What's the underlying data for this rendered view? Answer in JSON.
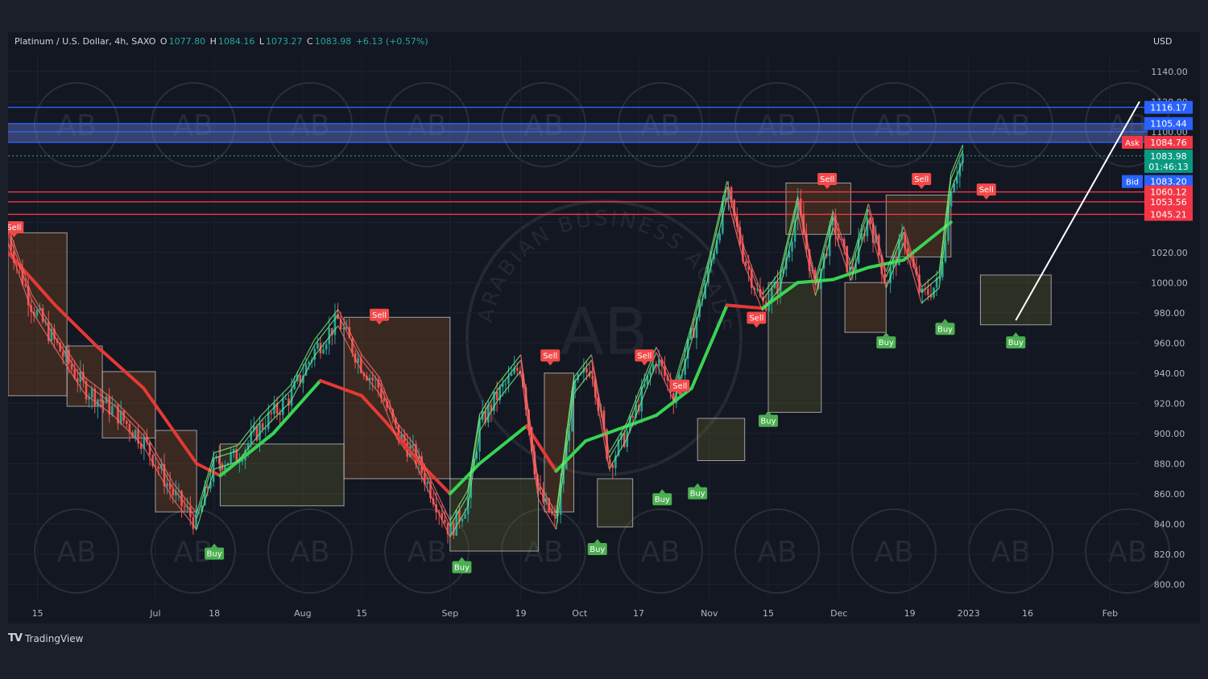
{
  "header": {
    "symbol": "Platinum / U.S. Dollar, 4h, SAXO",
    "open_label": "O",
    "open": "1077.80",
    "high_label": "H",
    "high": "1084.16",
    "low_label": "L",
    "low": "1073.27",
    "close_label": "C",
    "close": "1083.98",
    "change": "+6.13 (+0.57%)"
  },
  "currency": "USD",
  "footer": {
    "brand": "TradingView",
    "logo_icon": "tradingview-logo-icon"
  },
  "watermark": {
    "text": "ARABIAN BUSINESS ACADEMY",
    "monogram": "AB"
  },
  "colors": {
    "background": "#131722",
    "bull": "#26a69a",
    "bear": "#ef5350",
    "sell_label": "#f24a4a",
    "buy_label": "#4caf50",
    "resistance_blue": "#2962ff",
    "support_red": "#f23645",
    "trendline": "#ffffff"
  },
  "chart_data": {
    "type": "line",
    "title": "Platinum / U.S. Dollar, 4h, SAXO",
    "ylabel": "USD",
    "ylim": [
      790,
      1150
    ],
    "y_ticks": [
      "1140.00",
      "1120.00",
      "1100.00",
      "1020.00",
      "1000.00",
      "980.00",
      "960.00",
      "940.00",
      "920.00",
      "900.00",
      "880.00",
      "860.00",
      "840.00",
      "820.00",
      "800.00"
    ],
    "x_ticks": [
      "15",
      "Jul",
      "18",
      "Aug",
      "15",
      "Sep",
      "19",
      "Oct",
      "17",
      "Nov",
      "15",
      "Dec",
      "19",
      "2023",
      "16",
      "Feb"
    ],
    "x_tick_pos": [
      0.5,
      2.5,
      3.5,
      5.0,
      6.0,
      7.5,
      8.7,
      9.7,
      10.7,
      11.9,
      12.9,
      14.1,
      15.3,
      16.3,
      17.3,
      18.7
    ],
    "x_range": [
      0,
      19.2
    ],
    "series": [
      {
        "type": "price",
        "x": [
          0,
          0.4,
          0.8,
          1.3,
          1.8,
          2.3,
          2.8,
          3.2,
          3.5,
          3.9,
          4.3,
          4.8,
          5.2,
          5.6,
          6.0,
          6.3,
          6.6,
          6.9,
          7.2,
          7.5,
          7.8,
          8.0,
          8.3,
          8.7,
          9.0,
          9.3,
          9.6,
          9.9,
          10.2,
          10.5,
          10.8,
          11.0,
          11.3,
          11.6,
          11.9,
          12.2,
          12.5,
          12.8,
          13.1,
          13.4,
          13.7,
          14.0,
          14.3,
          14.6,
          14.9,
          15.2,
          15.5,
          15.8,
          16.0,
          16.2
        ],
        "values": [
          1030,
          985,
          960,
          930,
          915,
          895,
          860,
          840,
          880,
          885,
          905,
          925,
          955,
          975,
          945,
          930,
          900,
          885,
          860,
          835,
          855,
          905,
          925,
          945,
          860,
          840,
          930,
          945,
          880,
          900,
          930,
          950,
          925,
          965,
          1010,
          1060,
          1015,
          985,
          1000,
          1050,
          995,
          1040,
          1005,
          1045,
          1000,
          1030,
          990,
          1000,
          1065,
          1084
        ]
      },
      {
        "type": "supertrend",
        "x": [
          0,
          0.8,
          1.5,
          2.3,
          3.2,
          3.6,
          4.5,
          5.3,
          6.0,
          6.4,
          7.0,
          7.5,
          8.0,
          8.8,
          9.3,
          9.8,
          10.3,
          11.0,
          11.6,
          12.2,
          12.8,
          13.4,
          14.0,
          14.6,
          15.2,
          16.0
        ],
        "values": [
          1020,
          985,
          958,
          930,
          880,
          872,
          900,
          935,
          925,
          908,
          880,
          860,
          880,
          905,
          875,
          895,
          902,
          912,
          930,
          985,
          983,
          1000,
          1002,
          1010,
          1015,
          1040
        ]
      }
    ],
    "resistance_lines": [
      1116.17,
      1105.44,
      1100.0,
      1093.0
    ],
    "support_lines": [
      1060.12,
      1053.56,
      1045.21
    ],
    "price_labels": [
      {
        "label": "",
        "value": "1116.17",
        "y": 1116.17,
        "color": "#2962ff"
      },
      {
        "label": "",
        "value": "1105.44",
        "y": 1105.44,
        "color": "#2962ff"
      },
      {
        "label": "Ask",
        "value": "1084.76",
        "y": 1093.0,
        "color": "#f23645"
      },
      {
        "label": "",
        "value": "1083.98",
        "y": 1083.98,
        "color": "#089981"
      },
      {
        "label": "",
        "value": "01:46:13",
        "y": 1077.0,
        "color": "#089981"
      },
      {
        "label": "Bid",
        "value": "1083.20",
        "y": 1067.0,
        "color": "#2962ff"
      },
      {
        "label": "",
        "value": "1060.12",
        "y": 1060.12,
        "color": "#f23645"
      },
      {
        "label": "",
        "value": "1053.56",
        "y": 1053.56,
        "color": "#f23645"
      },
      {
        "label": "",
        "value": "1045.21",
        "y": 1045.21,
        "color": "#f23645"
      }
    ],
    "signals": [
      {
        "type": "Sell",
        "x": 0.1,
        "y": 1030
      },
      {
        "type": "Buy",
        "x": 3.5,
        "y": 827
      },
      {
        "type": "Sell",
        "x": 6.3,
        "y": 972
      },
      {
        "type": "Buy",
        "x": 7.7,
        "y": 818
      },
      {
        "type": "Sell",
        "x": 9.2,
        "y": 945
      },
      {
        "type": "Buy",
        "x": 10.0,
        "y": 830
      },
      {
        "type": "Sell",
        "x": 10.8,
        "y": 945
      },
      {
        "type": "Sell",
        "x": 11.4,
        "y": 925
      },
      {
        "type": "Buy",
        "x": 11.1,
        "y": 863
      },
      {
        "type": "Buy",
        "x": 11.7,
        "y": 867
      },
      {
        "type": "Sell",
        "x": 12.7,
        "y": 970
      },
      {
        "type": "Buy",
        "x": 12.9,
        "y": 915
      },
      {
        "type": "Sell",
        "x": 13.9,
        "y": 1062
      },
      {
        "type": "Buy",
        "x": 14.9,
        "y": 967
      },
      {
        "type": "Sell",
        "x": 15.5,
        "y": 1062
      },
      {
        "type": "Buy",
        "x": 15.9,
        "y": 976
      },
      {
        "type": "Sell",
        "x": 16.6,
        "y": 1055
      },
      {
        "type": "Buy",
        "x": 17.1,
        "y": 967
      }
    ],
    "boxes": [
      {
        "x0": 0.0,
        "x1": 1.0,
        "y0": 925,
        "y1": 1033,
        "kind": "bear"
      },
      {
        "x0": 1.0,
        "x1": 1.6,
        "y0": 918,
        "y1": 958,
        "kind": "bear"
      },
      {
        "x0": 1.6,
        "x1": 2.5,
        "y0": 897,
        "y1": 941,
        "kind": "bear"
      },
      {
        "x0": 2.5,
        "x1": 3.2,
        "y0": 848,
        "y1": 902,
        "kind": "bear"
      },
      {
        "x0": 3.6,
        "x1": 5.7,
        "y0": 852,
        "y1": 893,
        "kind": "bull"
      },
      {
        "x0": 5.7,
        "x1": 7.5,
        "y0": 870,
        "y1": 977,
        "kind": "bear"
      },
      {
        "x0": 7.5,
        "x1": 9.0,
        "y0": 822,
        "y1": 870,
        "kind": "bull"
      },
      {
        "x0": 9.1,
        "x1": 9.6,
        "y0": 848,
        "y1": 940,
        "kind": "bear"
      },
      {
        "x0": 10.0,
        "x1": 10.6,
        "y0": 838,
        "y1": 870,
        "kind": "bull"
      },
      {
        "x0": 11.7,
        "x1": 12.5,
        "y0": 882,
        "y1": 910,
        "kind": "bull"
      },
      {
        "x0": 12.9,
        "x1": 13.8,
        "y0": 914,
        "y1": 1000,
        "kind": "bull"
      },
      {
        "x0": 13.2,
        "x1": 14.3,
        "y0": 1032,
        "y1": 1066,
        "kind": "bear"
      },
      {
        "x0": 14.2,
        "x1": 14.9,
        "y0": 967,
        "y1": 1000,
        "kind": "bear"
      },
      {
        "x0": 14.9,
        "x1": 16.0,
        "y0": 1017,
        "y1": 1058,
        "kind": "bear"
      },
      {
        "x0": 16.5,
        "x1": 17.7,
        "y0": 972,
        "y1": 1005,
        "kind": "bull"
      }
    ],
    "trendline": [
      [
        17.1,
        975
      ],
      [
        19.2,
        1120
      ]
    ],
    "current_price": 1083.98
  }
}
